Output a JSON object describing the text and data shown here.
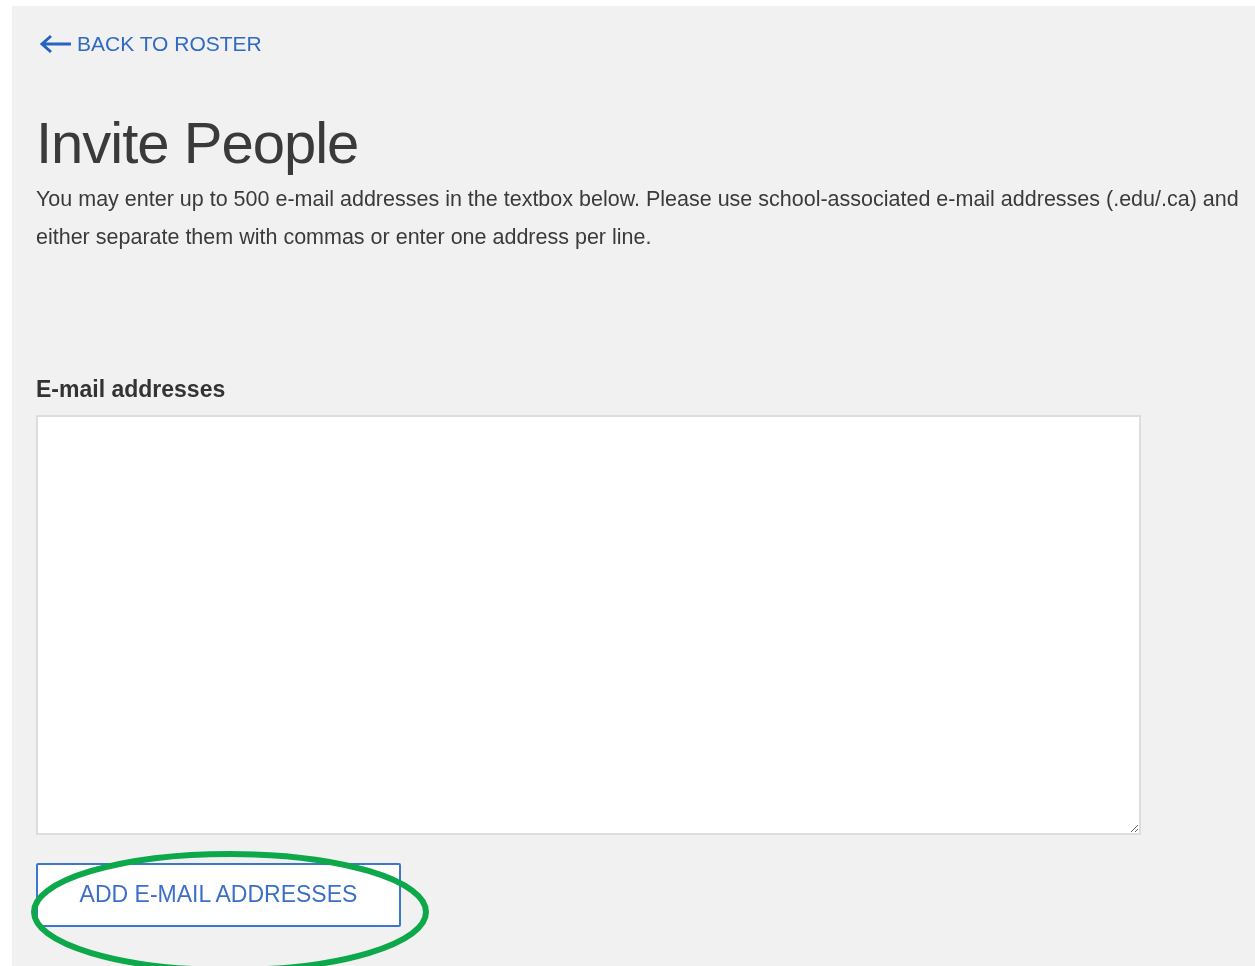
{
  "back_link": {
    "label": "BACK TO ROSTER"
  },
  "title": "Invite People",
  "description": "You may enter up to 500 e-mail addresses in the textbox below. Please use school-associated e-mail addresses (.edu/.ca) and either separate them with commas or enter one address per line.",
  "email_field": {
    "label": "E-mail addresses"
  },
  "submit_button": {
    "label": "ADD E-MAIL ADDRESSES"
  },
  "annotations": [
    {
      "kind": "ellipse"
    }
  ]
}
